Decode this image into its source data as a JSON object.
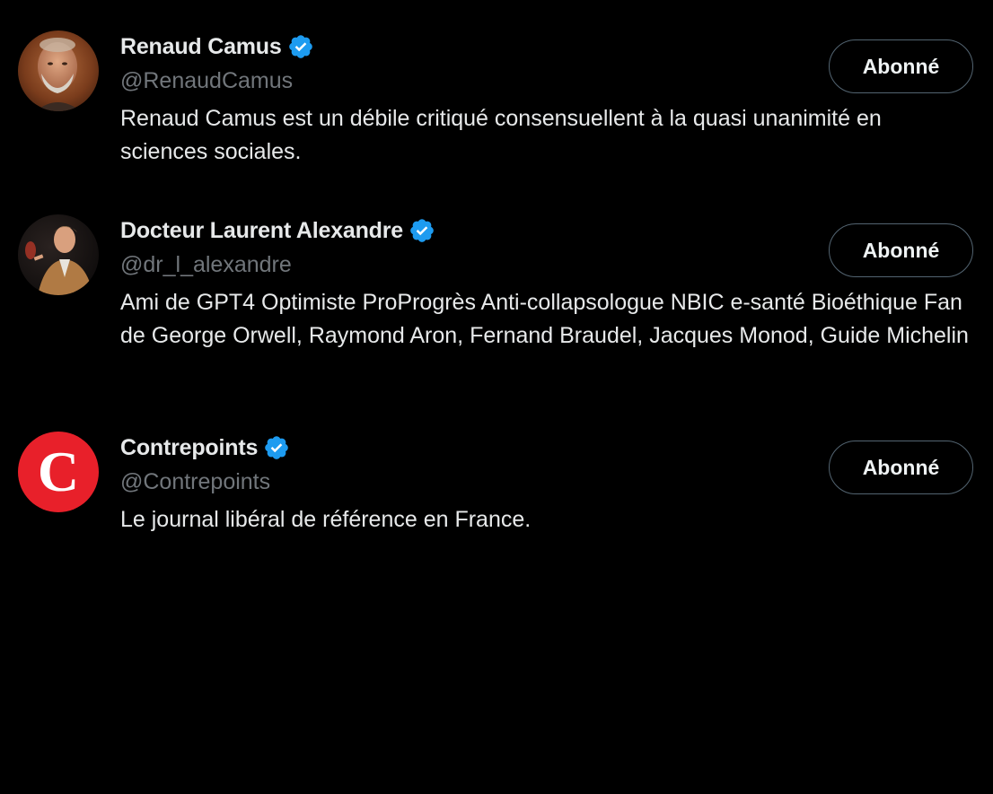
{
  "colors": {
    "background": "#000000",
    "text_primary": "#e7e9ea",
    "text_secondary": "#71767b",
    "verified_badge": "#1d9bf0",
    "button_border": "#536471",
    "contrepoints_red": "#e8202a"
  },
  "users": [
    {
      "display_name": "Renaud Camus",
      "handle": "@RenaudCamus",
      "verified": true,
      "bio": "Renaud Camus est un débile critiqué consensuellent à la quasi unanimité en sciences sociales.",
      "follow_label": "Abonné",
      "avatar_icon": "bearded-man-photo"
    },
    {
      "display_name": "Docteur Laurent Alexandre",
      "handle": "@dr_l_alexandre",
      "verified": true,
      "bio": "Ami de GPT4 Optimiste ProProgrès Anti-collapsologue NBIC e-santé Bioéthique Fan de George Orwell, Raymond Aron, Fernand Braudel, Jacques Monod, Guide Michelin",
      "follow_label": "Abonné",
      "avatar_icon": "speaker-on-stage-photo"
    },
    {
      "display_name": "Contrepoints",
      "handle": "@Contrepoints",
      "verified": true,
      "bio": "Le journal libéral de référence en France.",
      "follow_label": "Abonné",
      "avatar_icon": "contrepoints-c-logo",
      "avatar_letter": "C"
    }
  ]
}
